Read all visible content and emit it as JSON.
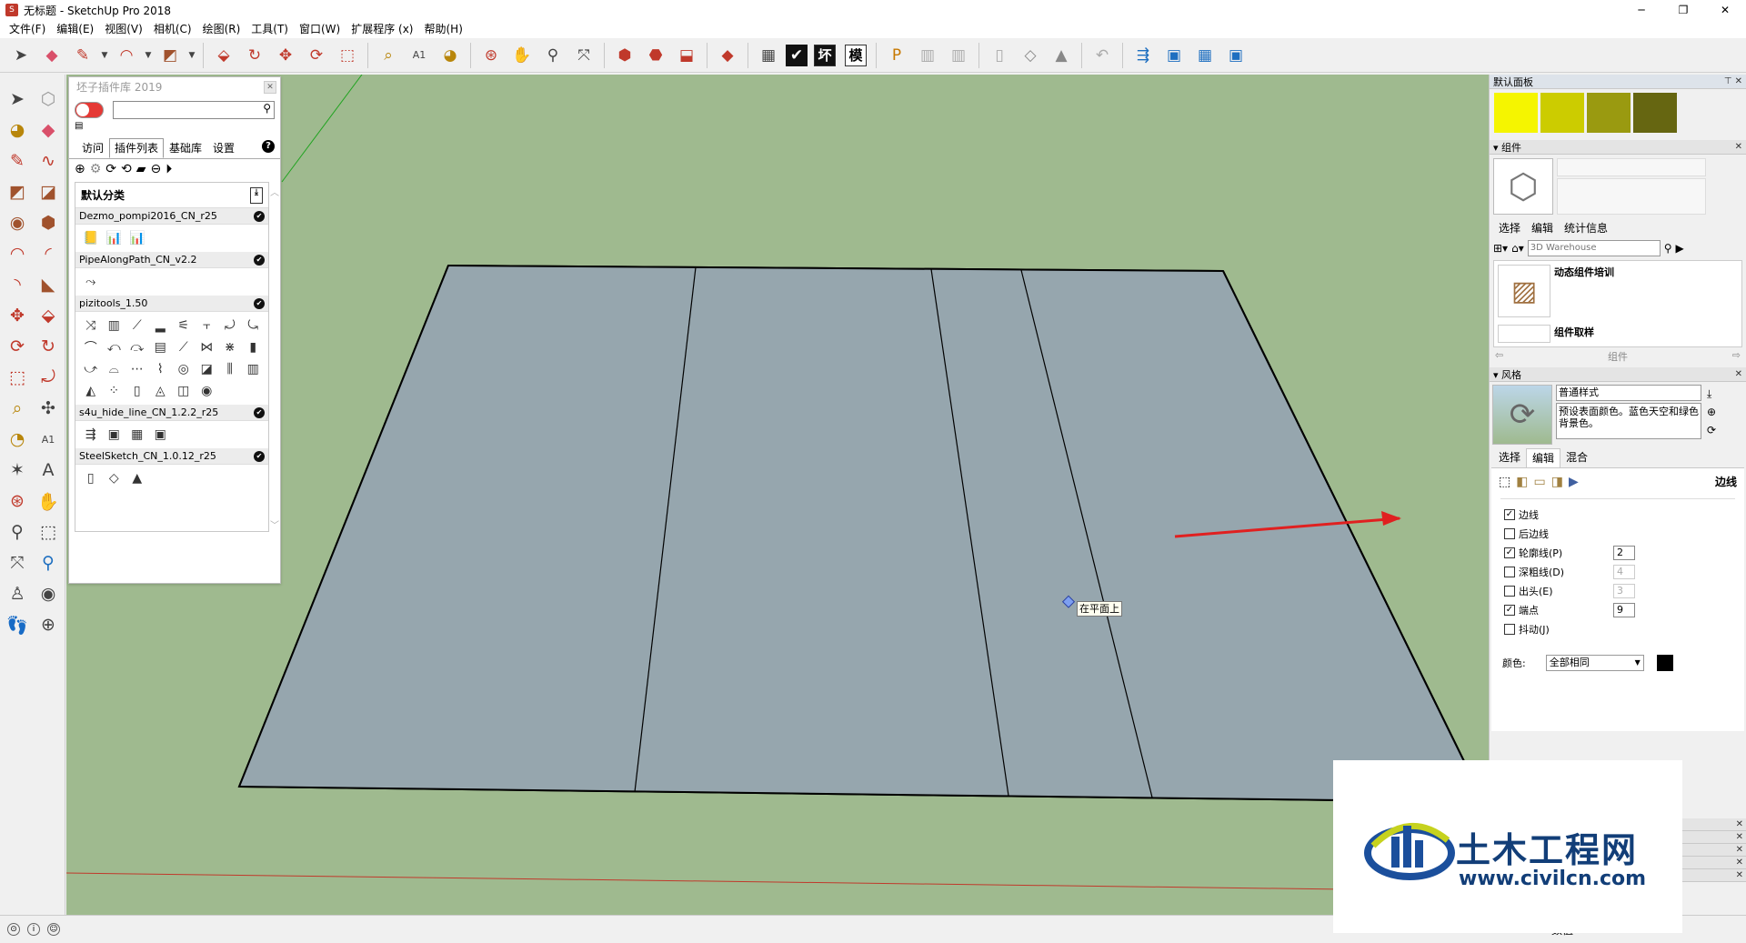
{
  "window": {
    "title": "无标题 - SketchUp Pro 2018",
    "minimize": "─",
    "restore": "❐",
    "close": "✕"
  },
  "menu": [
    "文件(F)",
    "编辑(E)",
    "视图(V)",
    "相机(C)",
    "绘图(R)",
    "工具(T)",
    "窗口(W)",
    "扩展程序 (x)",
    "帮助(H)"
  ],
  "toolbar": {
    "text_buttons": [
      "坏",
      "模"
    ]
  },
  "plugin_panel": {
    "title": "坯子插件库 2019",
    "tabs": [
      "访问",
      "插件列表",
      "基础库",
      "设置"
    ],
    "active_tab": "插件列表",
    "category": "默认分类",
    "plugins": [
      {
        "name": "Dezmo_pompi2016_CN_r25",
        "icons": [
          "📒",
          "📊",
          "📊"
        ]
      },
      {
        "name": "PipeAlongPath_CN_v2.2",
        "icons": [
          "⤳"
        ]
      },
      {
        "name": "pizitools_1.50",
        "icons": [
          "⤨",
          "▥",
          "⟋",
          "▂",
          "⚟",
          "⫟",
          "⤾",
          "⤿",
          "⌒",
          "⤺",
          "⤼",
          "▤",
          "⟋",
          "⋈",
          "⋇",
          "▮",
          "⤻",
          "⌓",
          "⋯",
          "⌇",
          "◎",
          "◪",
          "⫼",
          "▥",
          "◭",
          "⁘",
          "▯",
          "◬",
          "◫",
          "◉"
        ]
      },
      {
        "name": "s4u_hide_line_CN_1.2.2_r25",
        "icons": [
          "⇶",
          "▣",
          "▦",
          "▣"
        ]
      },
      {
        "name": "SteelSketch_CN_1.0.12_r25",
        "icons": [
          "▯",
          "◇",
          "▲"
        ]
      }
    ]
  },
  "viewport": {
    "tooltip": "在平面上",
    "sky_color": "#9fba8f",
    "face_color": "#96a6ae"
  },
  "tray": {
    "default_panel": "默认面板",
    "swatches": [
      "#f5f500",
      "#cccc00",
      "#9a9a10",
      "#666611"
    ],
    "components": {
      "title": "组件",
      "tabs": [
        "选择",
        "编辑",
        "统计信息"
      ],
      "search_placeholder": "3D Warehouse",
      "items": [
        "动态组件培训",
        "组件取样"
      ],
      "footer": "组件"
    },
    "styles": {
      "title": "风格",
      "name": "普通样式",
      "description": "预设表面颜色。蓝色天空和绿色背景色。",
      "tabs": [
        "选择",
        "编辑",
        "混合"
      ],
      "active_tab": "编辑",
      "section": "边线",
      "options": [
        {
          "label": "边线",
          "checked": true,
          "value": ""
        },
        {
          "label": "后边线",
          "checked": false,
          "value": ""
        },
        {
          "label": "轮廓线(P)",
          "checked": true,
          "value": "2"
        },
        {
          "label": "深粗线(D)",
          "checked": false,
          "value": "4"
        },
        {
          "label": "出头(E)",
          "checked": false,
          "value": "3"
        },
        {
          "label": "端点",
          "checked": true,
          "value": "9"
        },
        {
          "label": "抖动(J)",
          "checked": false,
          "value": ""
        }
      ],
      "color_label": "颜色:",
      "color_value": "全部相同"
    }
  },
  "status": {
    "value_label": "数值"
  },
  "watermark": {
    "cn": "土木工程网",
    "url": "www.civilcn.com"
  }
}
